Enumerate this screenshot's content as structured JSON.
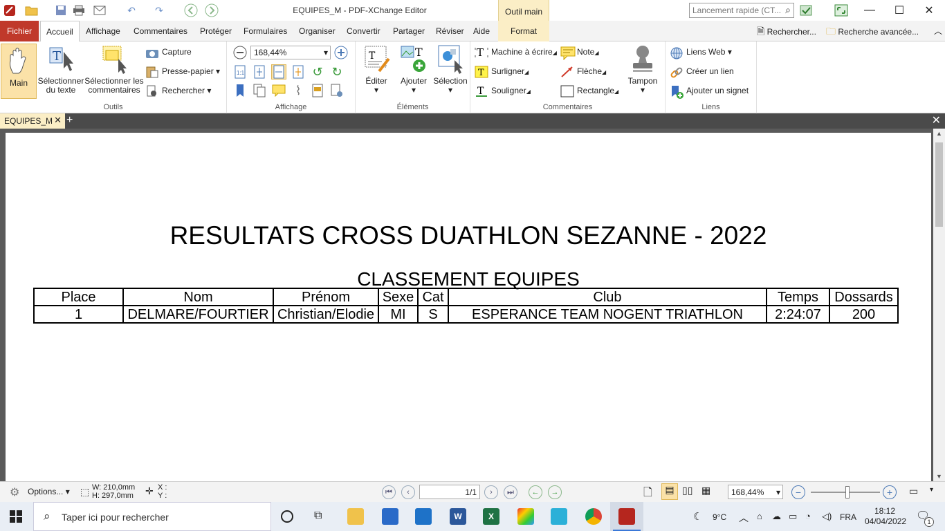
{
  "window": {
    "title": "EQUIPES_M - PDF-XChange Editor",
    "context_tab": "Outil main",
    "quick_launch_placeholder": "Lancement rapide (CT...",
    "controls": {
      "minimize": "—",
      "maximize": "☐",
      "close": "✕"
    }
  },
  "menu": {
    "fichier": "Fichier",
    "tabs": [
      "Accueil",
      "Affichage",
      "Commentaires",
      "Protéger",
      "Formulaires",
      "Organiser",
      "Convertir",
      "Partager",
      "Réviser",
      "Aide"
    ],
    "format": "Format",
    "search": "Rechercher...",
    "advanced_search": "Recherche avancée..."
  },
  "ribbon": {
    "outils": {
      "label": "Outils",
      "main": "Main",
      "select_text_1": "Sélectionner",
      "select_text_2": "du texte",
      "select_comments_1": "Sélectionner les",
      "select_comments_2": "commentaires",
      "capture": "Capture",
      "clipboard": "Presse-papier",
      "search": "Rechercher"
    },
    "affichage": {
      "label": "Affichage",
      "zoom": "168,44%"
    },
    "elements": {
      "label": "Éléments",
      "edit": "Éditer",
      "add": "Ajouter",
      "selection": "Sélection"
    },
    "commentaires": {
      "label": "Commentaires",
      "typewriter": "Machine à écrire",
      "note": "Note",
      "highlight": "Surligner",
      "arrow": "Flèche",
      "underline": "Souligner",
      "rectangle": "Rectangle",
      "stamp": "Tampon"
    },
    "liens": {
      "label": "Liens",
      "web_links": "Liens Web",
      "create_link": "Créer un lien",
      "add_bookmark": "Ajouter un signet"
    }
  },
  "doc_tab": {
    "name": "EQUIPES_M",
    "close": "✕",
    "add": "+"
  },
  "document": {
    "title": "RESULTATS CROSS DUATHLON SEZANNE - 2022",
    "subtitle": "CLASSEMENT EQUIPES",
    "headers": [
      "Place",
      "Nom",
      "Prénom",
      "Sexe",
      "Cat",
      "Club",
      "Temps",
      "Dossards"
    ],
    "rows": [
      [
        "1",
        "DELMARE/FOURTIER",
        "Christian/Elodie",
        "MI",
        "S",
        "ESPERANCE TEAM NOGENT TRIATHLON",
        "2:24:07",
        "200"
      ]
    ]
  },
  "statusbar": {
    "options": "Options...",
    "width": "W: 210,0mm",
    "height": "H: 297,0mm",
    "x": "X :",
    "y": "Y :",
    "page": "1/1",
    "zoom": "168,44%"
  },
  "taskbar": {
    "search_placeholder": "Taper ici pour rechercher",
    "weather": "9°C",
    "lang": "FRA",
    "time": "18:12",
    "date": "04/04/2022",
    "notifications": "1"
  },
  "colors": {
    "fichier": "#c0392b",
    "context": "#fbeec6",
    "doc_bg": "#5a5a5a"
  }
}
